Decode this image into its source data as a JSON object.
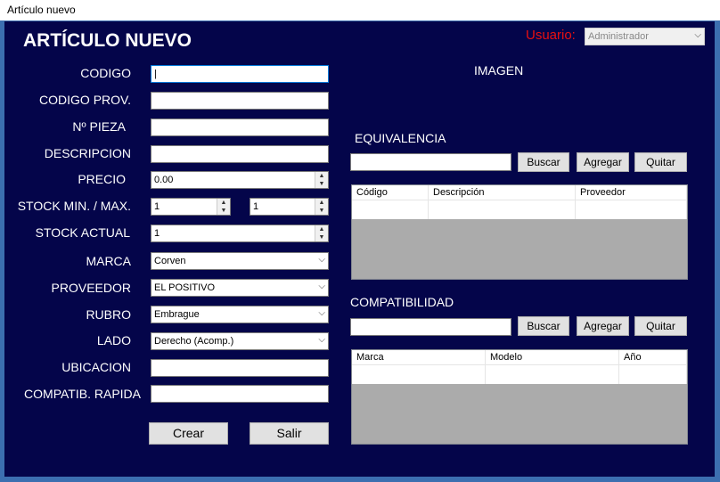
{
  "window": {
    "title": "Artículo nuevo"
  },
  "header": {
    "title": "ARTÍCULO NUEVO",
    "user_label": "Usuario:",
    "user_value": "Administrador"
  },
  "form": {
    "codigo_label": "CODIGO",
    "codigo_value": "|",
    "codigo_prov_label": "CODIGO PROV.",
    "pieza_label": "Nº PIEZA",
    "descripcion_label": "DESCRIPCION",
    "precio_label": "PRECIO",
    "precio_value": "0.00",
    "stock_minmax_label": "STOCK MIN. / MAX.",
    "stock_min_value": "1",
    "stock_max_value": "1",
    "stock_actual_label": "STOCK ACTUAL",
    "stock_actual_value": "1",
    "marca_label": "MARCA",
    "marca_value": "Corven",
    "proveedor_label": "PROVEEDOR",
    "proveedor_value": "EL POSITIVO",
    "rubro_label": "RUBRO",
    "rubro_value": "Embrague",
    "lado_label": "LADO",
    "lado_value": "Derecho (Acomp.)",
    "ubicacion_label": "UBICACION",
    "compatib_label": "COMPATIB. RAPIDA",
    "crear_label": "Crear",
    "salir_label": "Salir"
  },
  "imagen": {
    "label": "IMAGEN"
  },
  "equivalencia": {
    "title": "EQUIVALENCIA",
    "buscar": "Buscar",
    "agregar": "Agregar",
    "quitar": "Quitar",
    "columns": [
      "Código",
      "Descripción",
      "Proveedor"
    ]
  },
  "compatibilidad": {
    "title": "COMPATIBILIDAD",
    "buscar": "Buscar",
    "agregar": "Agregar",
    "quitar": "Quitar",
    "columns": [
      "Marca",
      "Modelo",
      "Año"
    ]
  },
  "colors": {
    "background": "#04054a",
    "user_label": "#e81010"
  }
}
